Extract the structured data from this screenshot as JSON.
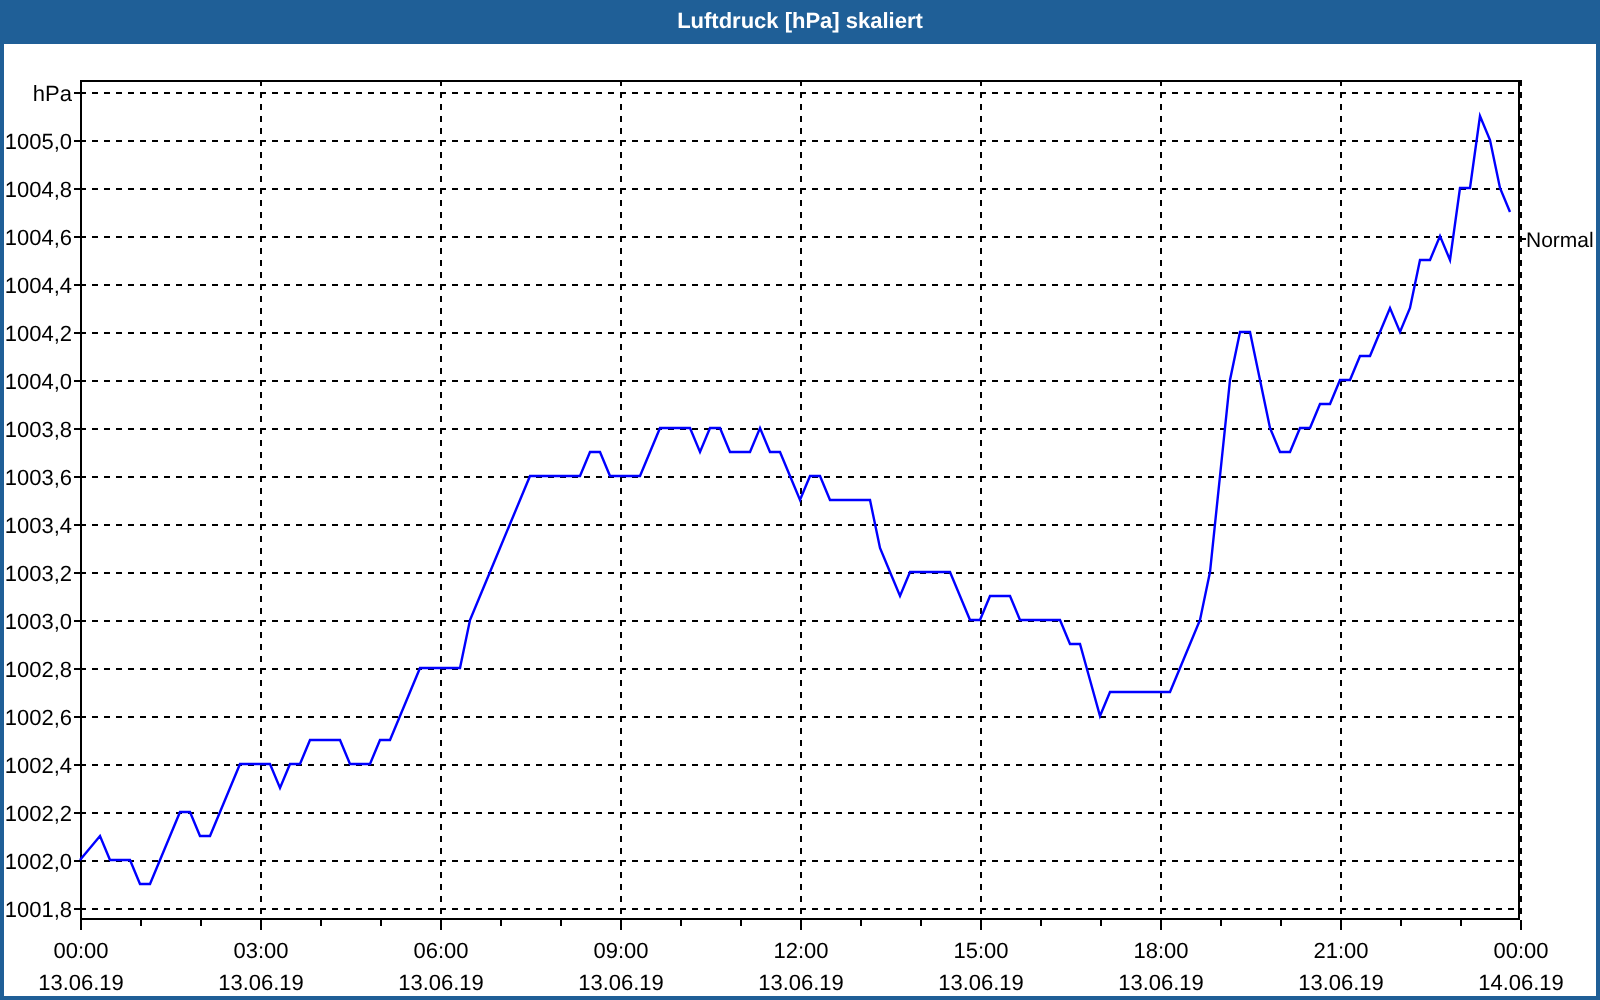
{
  "window": {
    "title": "Luftdruck [hPa] skaliert"
  },
  "chart": {
    "chart_data": {
      "type": "line",
      "categories": [
        "00:00\n13.06.19",
        null,
        null,
        null,
        null,
        null,
        null,
        null,
        null,
        null,
        null,
        null,
        null,
        null,
        null,
        null,
        null,
        null,
        "03:00\n13.06.19",
        null,
        null,
        null,
        null,
        null,
        null,
        null,
        null,
        null,
        null,
        null,
        null,
        null,
        null,
        null,
        null,
        null,
        "06:00\n13.06.19",
        null,
        null,
        null,
        null,
        null,
        null,
        null,
        null,
        null,
        null,
        null,
        null,
        null,
        null,
        null,
        null,
        null,
        "09:00\n13.06.19",
        null,
        null,
        null,
        null,
        null,
        null,
        null,
        null,
        null,
        null,
        null,
        null,
        null,
        null,
        null,
        null,
        null,
        "12:00\n13.06.19",
        null,
        null,
        null,
        null,
        null,
        null,
        null,
        null,
        null,
        null,
        null,
        null,
        null,
        null,
        null,
        null,
        null,
        "15:00\n13.06.19",
        null,
        null,
        null,
        null,
        null,
        null,
        null,
        null,
        null,
        null,
        null,
        null,
        null,
        null,
        null,
        null,
        null,
        "18:00\n13.06.19",
        null,
        null,
        null,
        null,
        null,
        null,
        null,
        null,
        null,
        null,
        null,
        null,
        null,
        null,
        null,
        null,
        null,
        "21:00\n13.06.19",
        null,
        null,
        null,
        null,
        null,
        null,
        null,
        null,
        null,
        null,
        null,
        null,
        null,
        null,
        null,
        null,
        null,
        "00:00\n14.06.19"
      ],
      "series": [
        {
          "color": "#0000ff",
          "values": [
            1002.0,
            1002.05,
            1002.1,
            1002.0,
            1002.0,
            1002.0,
            1001.9,
            1001.9,
            1002.0,
            1002.1,
            1002.2,
            1002.2,
            1002.1,
            1002.1,
            1002.2,
            1002.3,
            1002.4,
            1002.4,
            1002.4,
            1002.4,
            1002.3,
            1002.4,
            1002.4,
            1002.5,
            1002.5,
            1002.5,
            1002.5,
            1002.4,
            1002.4,
            1002.4,
            1002.5,
            1002.5,
            1002.6,
            1002.7,
            1002.8,
            1002.8,
            1002.8,
            1002.8,
            1002.8,
            1003.0,
            1003.1,
            1003.2,
            1003.3,
            1003.4,
            1003.5,
            1003.6,
            1003.6,
            1003.6,
            1003.6,
            1003.6,
            1003.6,
            1003.7,
            1003.7,
            1003.6,
            1003.6,
            1003.6,
            1003.6,
            1003.7,
            1003.8,
            1003.8,
            1003.8,
            1003.8,
            1003.7,
            1003.8,
            1003.8,
            1003.7,
            1003.7,
            1003.7,
            1003.8,
            1003.7,
            1003.7,
            1003.6,
            1003.5,
            1003.6,
            1003.6,
            1003.5,
            1003.5,
            1003.5,
            1003.5,
            1003.5,
            1003.3,
            1003.2,
            1003.1,
            1003.2,
            1003.2,
            1003.2,
            1003.2,
            1003.2,
            1003.1,
            1003.0,
            1003.0,
            1003.1,
            1003.1,
            1003.1,
            1003.0,
            1003.0,
            1003.0,
            1003.0,
            1003.0,
            1002.9,
            1002.9,
            1002.75,
            1002.6,
            1002.7,
            1002.7,
            1002.7,
            1002.7,
            1002.7,
            1002.7,
            1002.7,
            1002.8,
            1002.9,
            1003.0,
            1003.2,
            1003.6,
            1004.0,
            1004.2,
            1004.2,
            1004.0,
            1003.8,
            1003.7,
            1003.7,
            1003.8,
            1003.8,
            1003.9,
            1003.9,
            1004.0,
            1004.0,
            1004.1,
            1004.1,
            1004.2,
            1004.3,
            1004.2,
            1004.3,
            1004.5,
            1004.5,
            1004.6,
            1004.5,
            1004.8,
            1004.8,
            1005.1,
            1005.0,
            1004.8,
            1004.7,
            null
          ]
        }
      ],
      "ylim": [
        1001.75,
        1005.25
      ],
      "grid": true,
      "yticks": [
        {
          "value": 1001.8,
          "label": "1001,8"
        },
        {
          "value": 1002.0,
          "label": "1002,0"
        },
        {
          "value": 1002.2,
          "label": "1002,2"
        },
        {
          "value": 1002.4,
          "label": "1002,4"
        },
        {
          "value": 1002.6,
          "label": "1002,6"
        },
        {
          "value": 1002.8,
          "label": "1002,8"
        },
        {
          "value": 1003.0,
          "label": "1003,0"
        },
        {
          "value": 1003.2,
          "label": "1003,2"
        },
        {
          "value": 1003.4,
          "label": "1003,4"
        },
        {
          "value": 1003.6,
          "label": "1003,6"
        },
        {
          "value": 1003.8,
          "label": "1003,8"
        },
        {
          "value": 1004.0,
          "label": "1004,0"
        },
        {
          "value": 1004.2,
          "label": "1004,2"
        },
        {
          "value": 1004.4,
          "label": "1004,4"
        },
        {
          "value": 1004.6,
          "label": "1004,6"
        },
        {
          "value": 1004.8,
          "label": "1004,8"
        },
        {
          "value": 1005.0,
          "label": "1005,0"
        },
        {
          "value": 1005.2,
          "label": "hPa"
        }
      ],
      "annotations": [
        "Normal"
      ]
    }
  }
}
